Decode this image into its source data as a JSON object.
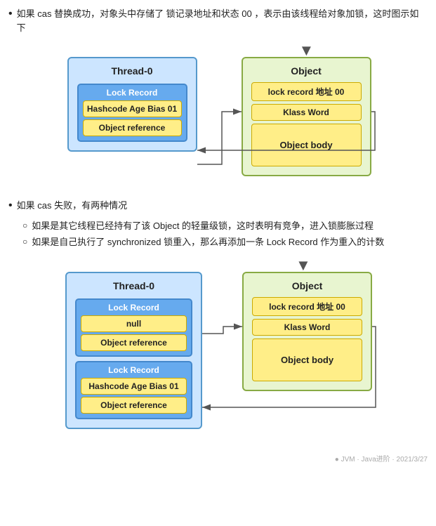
{
  "intro": {
    "bullet1": "如果 cas 替换成功，对象头中存储了 锁记录地址和状态 00 ，表示由该线程给对象加锁，这时图示如下",
    "bullet2": "如果 cas 失败，有两种情况",
    "sub1": "如果是其它线程已经持有了该 Object 的轻量级锁，这时表明有竞争，进入锁膨胀过程",
    "sub2": "如果是自己执行了 synchronized 锁重入，那么再添加一条 Lock Record 作为重入的计数"
  },
  "diagram1": {
    "thread": {
      "title": "Thread-0",
      "lockRecord": {
        "label": "Lock Record",
        "field1": "Hashcode Age Bias 01",
        "field2": "Object reference"
      }
    },
    "object": {
      "title": "Object",
      "field1": "lock  record 地址 00",
      "field2": "Klass Word",
      "body": "Object body"
    }
  },
  "diagram2": {
    "thread": {
      "title": "Thread-0",
      "lockRecord1": {
        "label": "Lock Record",
        "field1": "null",
        "field2": "Object reference"
      },
      "lockRecord2": {
        "label": "Lock Record",
        "field1": "Hashcode Age Bias 01",
        "field2": "Object reference"
      }
    },
    "object": {
      "title": "Object",
      "field1": "lock  record 地址 00",
      "field2": "Klass Word",
      "body": "Object body"
    }
  },
  "watermark": "● JVM · Java进阶 · 2021/3/27"
}
